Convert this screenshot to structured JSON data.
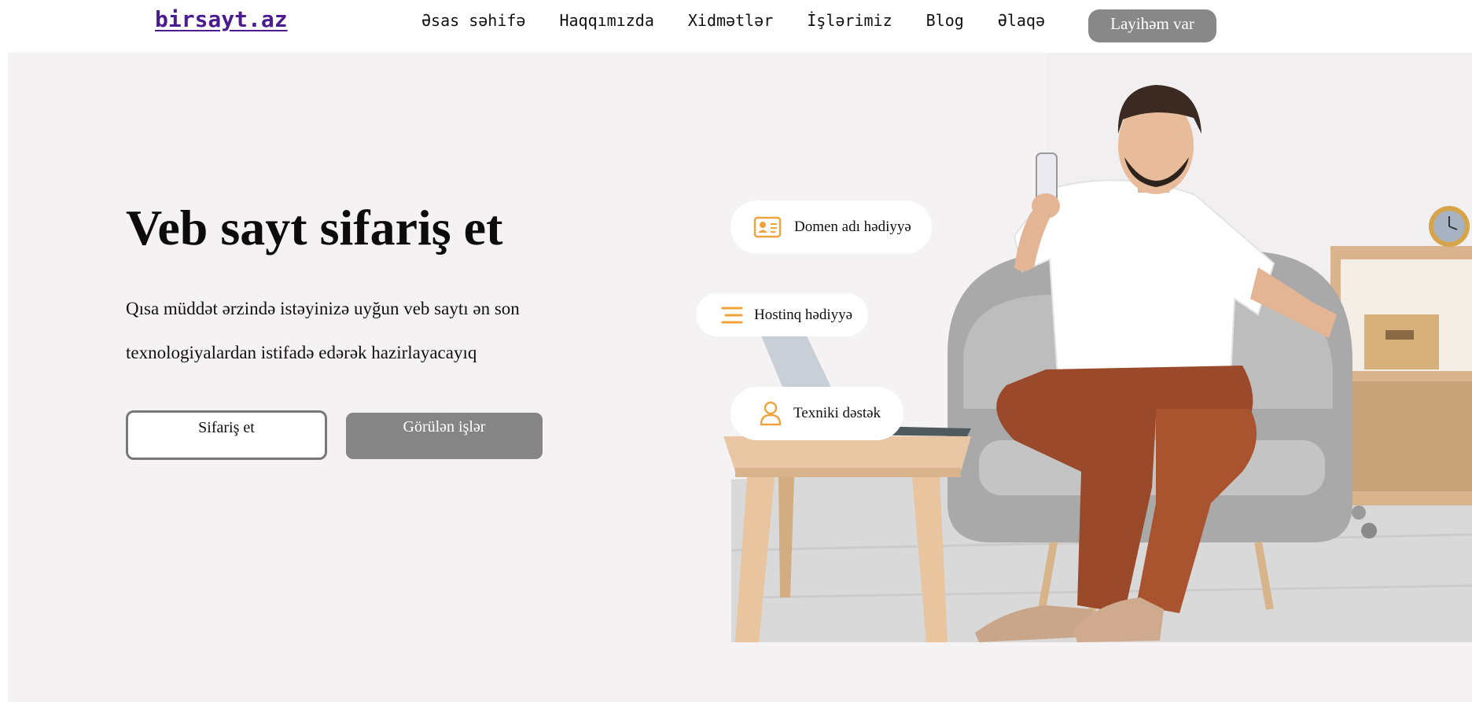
{
  "header": {
    "logo": "birsayt.az",
    "nav": [
      "Əsas səhifə",
      "Haqqımızda",
      "Xidmətlər",
      "İşlərimiz",
      "Blog",
      "Əlaqə"
    ],
    "cta_label": "Layihəm var"
  },
  "hero": {
    "title": "Veb sayt sifariş et",
    "lead": "Qısa müddət ərzində istəyinizə uyğun veb saytı ən son texnologiyalardan istifadə edərək hazirlayacayıq",
    "order_button": "Sifariş et",
    "works_button": "Görülən işlər",
    "features": [
      {
        "label": "Domen adı hədiyyə",
        "icon": "id-card-icon"
      },
      {
        "label": "Hostinq hədiyyə",
        "icon": "menu-lines-icon"
      },
      {
        "label": "Texniki dəstək",
        "icon": "user-icon"
      }
    ]
  },
  "colors": {
    "brand": "#4b1c8f",
    "accent": "#f0a33a",
    "button_gray": "#858585",
    "hero_bg": "#f4f2f2"
  }
}
